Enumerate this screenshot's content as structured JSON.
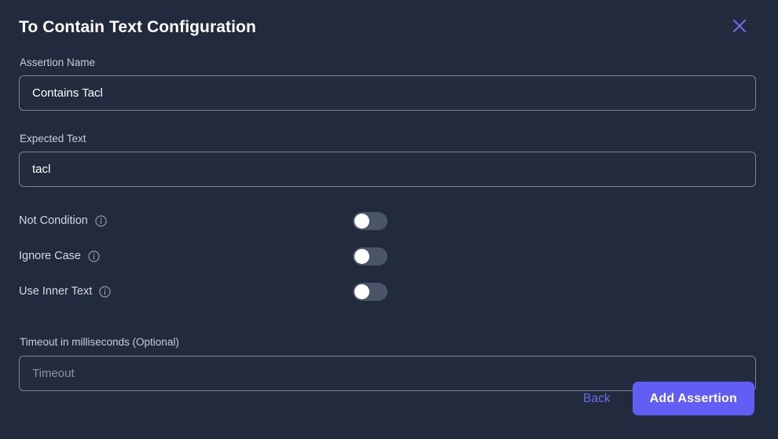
{
  "dialog": {
    "title": "To Contain Text Configuration",
    "close_icon": "close-icon",
    "accent_color": "#625df5",
    "background_color": "#212b3d",
    "border_color": "#79849a"
  },
  "fields": {
    "assertion_name": {
      "label": "Assertion Name",
      "value": "Contains Tacl",
      "placeholder": ""
    },
    "expected_text": {
      "label": "Expected Text",
      "value": "tacl",
      "placeholder": ""
    },
    "timeout": {
      "label": "Timeout in milliseconds (Optional)",
      "value": "",
      "placeholder": "Timeout"
    }
  },
  "toggles": [
    {
      "label": "Not Condition",
      "state": "off",
      "info_icon": "info-circle-icon"
    },
    {
      "label": "Ignore Case",
      "state": "off",
      "info_icon": "info-circle-icon"
    },
    {
      "label": "Use Inner Text",
      "state": "off",
      "info_icon": "info-circle-icon"
    }
  ],
  "footer": {
    "back_label": "Back",
    "submit_label": "Add Assertion"
  }
}
